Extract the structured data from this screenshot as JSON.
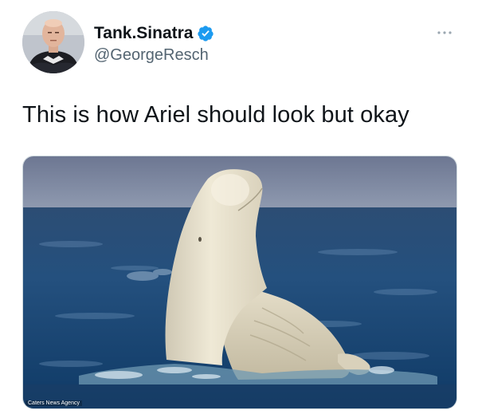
{
  "tweet": {
    "author": {
      "display_name": "Tank.Sinatra",
      "handle": "@GeorgeResch",
      "verified": true
    },
    "text": "This is how Ariel should look but okay",
    "media": {
      "subject": "beluga-whale-photo",
      "watermark": "Caters News Agency"
    }
  },
  "icons": {
    "verified": "verified-badge-icon",
    "more": "more-options-icon"
  },
  "colors": {
    "verified_blue": "#1d9bf0",
    "text_primary": "#0f1419",
    "text_secondary": "#536471"
  }
}
